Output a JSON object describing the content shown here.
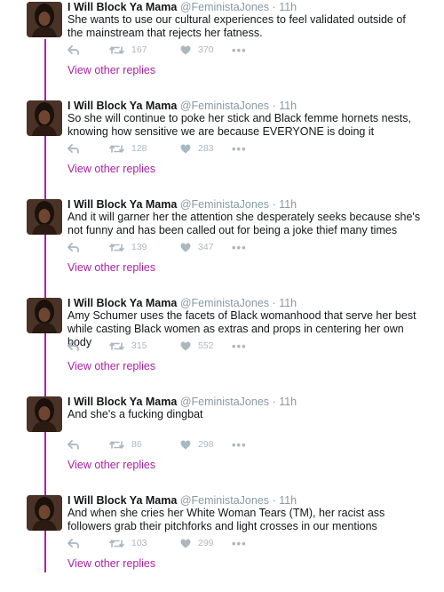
{
  "colors": {
    "accent": "#b01fa8",
    "muted": "#aab8c2",
    "handle": "#8899a6"
  },
  "icons": {
    "reply": "reply-icon",
    "retweet": "retweet-icon",
    "like": "heart-icon",
    "more": "more-icon"
  },
  "tweets": [
    {
      "name": "I Will Block Ya Mama",
      "handle": "@FeministaJones",
      "sep": "·",
      "time": "11h",
      "text": "She wants to use our cultural experiences to feel validated outside of the mainstream that rejects her fatness.",
      "retweets": "167",
      "likes": "370",
      "more": "•••",
      "view_replies": "View other replies"
    },
    {
      "name": "I Will Block Ya Mama",
      "handle": "@FeministaJones",
      "sep": "·",
      "time": "11h",
      "text": "So she will continue to poke her stick and Black femme hornets nests, knowing how sensitive we are because EVERYONE is doing it",
      "retweets": "128",
      "likes": "283",
      "more": "•••",
      "view_replies": "View other replies"
    },
    {
      "name": "I Will Block Ya Mama",
      "handle": "@FeministaJones",
      "sep": "·",
      "time": "11h",
      "text": "And it will garner her the attention she desperately seeks because she's not funny and has been called out for being a joke thief many times",
      "retweets": "139",
      "likes": "347",
      "more": "•••",
      "view_replies": "View other replies"
    },
    {
      "name": "I Will Block Ya Mama",
      "handle": "@FeministaJones",
      "sep": "·",
      "time": "11h",
      "text": "Amy Schumer uses the facets of Black womanhood that serve her best while casting Black women as extras and props in centering her own body",
      "retweets": "315",
      "likes": "552",
      "more": "•••",
      "view_replies": "View other replies"
    },
    {
      "name": "I Will Block Ya Mama",
      "handle": "@FeministaJones",
      "sep": "·",
      "time": "11h",
      "text": "And she's a fucking dingbat",
      "retweets": "86",
      "likes": "298",
      "more": "•••",
      "view_replies": "View other replies"
    },
    {
      "name": "I Will Block Ya Mama",
      "handle": "@FeministaJones",
      "sep": "·",
      "time": "11h",
      "text": "And when she cries her White Woman Tears (TM), her racist ass followers grab their pitchforks and light crosses in our mentions",
      "retweets": "103",
      "likes": "299",
      "more": "•••",
      "view_replies": "View other replies"
    }
  ]
}
